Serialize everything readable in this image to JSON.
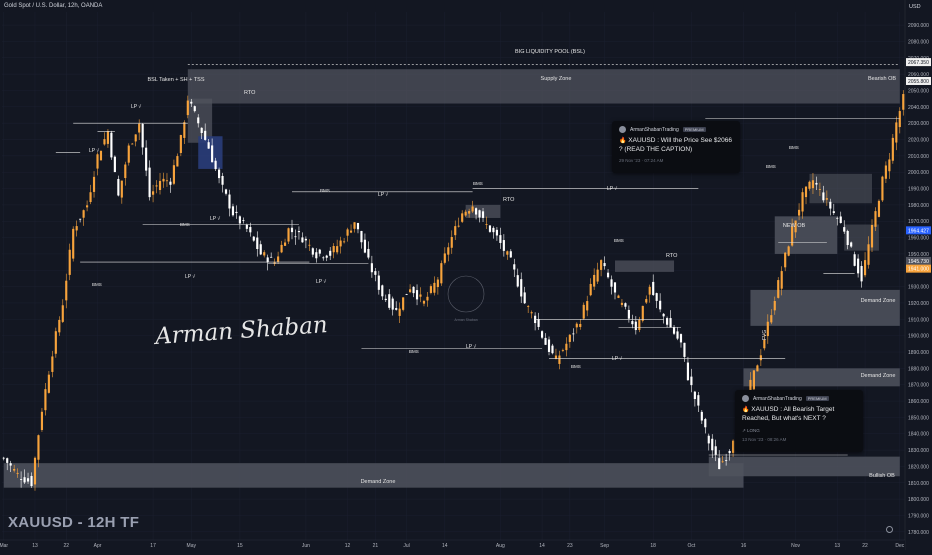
{
  "header": {
    "title": "Gold Spot / U.S. Dollar, 12h, OANDA",
    "currency": "USD"
  },
  "watermark": {
    "symbol": "XAUUSD - 12H TF",
    "signature": "Arman Shaban",
    "center_logo": "Arman Shaban"
  },
  "colors": {
    "background": "#131722",
    "up_candle": "#f7a33c",
    "down_candle": "#ffffff",
    "zone_fill": "#50535e",
    "zone_fill_dark": "#3b3e48",
    "rto_fill": "#2a3d7a",
    "grid": "#1c2030"
  },
  "price_axis": {
    "ticks": [
      "2090.000",
      "2080.000",
      "2070.000",
      "2060.000",
      "2050.000",
      "2040.000",
      "2030.000",
      "2020.000",
      "2010.000",
      "2000.000",
      "1990.000",
      "1980.000",
      "1970.000",
      "1960.000",
      "1950.000",
      "1940.000",
      "1930.000",
      "1920.000",
      "1910.000",
      "1900.000",
      "1890.000",
      "1880.000",
      "1870.000",
      "1860.000",
      "1850.000",
      "1840.000",
      "1830.000",
      "1820.000",
      "1810.000",
      "1800.000",
      "1790.000",
      "1780.000"
    ],
    "highlights": [
      {
        "label": "1964.427",
        "color": "#2962ff"
      },
      {
        "label": "1945.730",
        "color": "#50535e"
      },
      {
        "label": "1941.000",
        "color": "#f7a33c"
      },
      {
        "label": "2067.350",
        "color": "#f0f0f0"
      },
      {
        "label": "2055.800",
        "color": "#f0f0f0"
      }
    ],
    "countdown": "06:02:15"
  },
  "time_axis": {
    "ticks": [
      {
        "label": "Mar",
        "i": 0
      },
      {
        "label": "13",
        "i": 9
      },
      {
        "label": "22",
        "i": 18
      },
      {
        "label": "Apr",
        "i": 27
      },
      {
        "label": "17",
        "i": 43
      },
      {
        "label": "May",
        "i": 54
      },
      {
        "label": "15",
        "i": 68
      },
      {
        "label": "Jun",
        "i": 87
      },
      {
        "label": "12",
        "i": 99
      },
      {
        "label": "21",
        "i": 107
      },
      {
        "label": "Jul",
        "i": 116
      },
      {
        "label": "14",
        "i": 127
      },
      {
        "label": "Aug",
        "i": 143
      },
      {
        "label": "14",
        "i": 155
      },
      {
        "label": "23",
        "i": 163
      },
      {
        "label": "Sep",
        "i": 173
      },
      {
        "label": "18",
        "i": 187
      },
      {
        "label": "Oct",
        "i": 198
      },
      {
        "label": "16",
        "i": 213
      },
      {
        "label": "Nov",
        "i": 228
      },
      {
        "label": "13",
        "i": 240
      },
      {
        "label": "22",
        "i": 248
      },
      {
        "label": "Dec",
        "i": 258
      }
    ]
  },
  "annotations": {
    "big_liquidity": "BIG LIQUIDITY POOL (BSL)",
    "supply_zone": "Supply Zone",
    "bearish_ob": "Bearish OB",
    "bsl_taken": "BSL Taken + SH + TSS",
    "rto": "RTO",
    "lp": "LP",
    "bms": "BMS",
    "new_ob": "NEW OB",
    "demand_zone": "Demand Zone",
    "bullish_ob": "Bullish OB",
    "fvg": "FVG"
  },
  "ideas": [
    {
      "author": "ArmanShabanTrading",
      "badge": "PREMIUM",
      "title": "XAUUSD : Will the Price See $2066 ? (READ THE CAPTION)",
      "date": "29 Nov '23 · 07:24 AM",
      "tag": ""
    },
    {
      "author": "ArmanShabanTrading",
      "badge": "PREMIUM",
      "title": "XAUUSD : All Bearish Target Reached, But what's NEXT ?",
      "date": "13 Nov '23 · 08:26 AM",
      "tag": "LONG"
    }
  ],
  "chart_data": {
    "type": "candlestick",
    "title": "Gold Spot / U.S. Dollar, 12h, OANDA",
    "ylabel": "USD",
    "ylim": [
      1775,
      2098
    ],
    "x_count": 260,
    "anchors": [
      [
        0,
        1825
      ],
      [
        4,
        1815
      ],
      [
        8,
        1810
      ],
      [
        11,
        1855
      ],
      [
        14,
        1890
      ],
      [
        17,
        1920
      ],
      [
        20,
        1965
      ],
      [
        24,
        1980
      ],
      [
        27,
        2010
      ],
      [
        30,
        2025
      ],
      [
        33,
        1985
      ],
      [
        36,
        2015
      ],
      [
        39,
        2030
      ],
      [
        42,
        1985
      ],
      [
        45,
        1995
      ],
      [
        48,
        1995
      ],
      [
        51,
        2020
      ],
      [
        53,
        2045
      ],
      [
        56,
        2030
      ],
      [
        59,
        2015
      ],
      [
        62,
        1995
      ],
      [
        66,
        1975
      ],
      [
        70,
        1965
      ],
      [
        74,
        1950
      ],
      [
        78,
        1945
      ],
      [
        82,
        1965
      ],
      [
        86,
        1960
      ],
      [
        90,
        1950
      ],
      [
        94,
        1950
      ],
      [
        98,
        1960
      ],
      [
        101,
        1970
      ],
      [
        105,
        1945
      ],
      [
        109,
        1925
      ],
      [
        113,
        1915
      ],
      [
        117,
        1930
      ],
      [
        121,
        1920
      ],
      [
        125,
        1935
      ],
      [
        128,
        1955
      ],
      [
        132,
        1975
      ],
      [
        135,
        1980
      ],
      [
        138,
        1970
      ],
      [
        142,
        1960
      ],
      [
        146,
        1945
      ],
      [
        150,
        1920
      ],
      [
        153,
        1910
      ],
      [
        156,
        1895
      ],
      [
        159,
        1885
      ],
      [
        162,
        1895
      ],
      [
        166,
        1910
      ],
      [
        169,
        1930
      ],
      [
        172,
        1945
      ],
      [
        176,
        1925
      ],
      [
        179,
        1915
      ],
      [
        182,
        1905
      ],
      [
        186,
        1930
      ],
      [
        189,
        1915
      ],
      [
        192,
        1905
      ],
      [
        195,
        1895
      ],
      [
        197,
        1875
      ],
      [
        200,
        1855
      ],
      [
        203,
        1835
      ],
      [
        206,
        1820
      ],
      [
        209,
        1830
      ],
      [
        212,
        1855
      ],
      [
        215,
        1870
      ],
      [
        218,
        1890
      ],
      [
        221,
        1915
      ],
      [
        224,
        1940
      ],
      [
        227,
        1965
      ],
      [
        230,
        1985
      ],
      [
        233,
        1995
      ],
      [
        236,
        1985
      ],
      [
        239,
        1975
      ],
      [
        242,
        1965
      ],
      [
        245,
        1945
      ],
      [
        247,
        1935
      ],
      [
        249,
        1955
      ],
      [
        251,
        1975
      ],
      [
        253,
        1995
      ],
      [
        255,
        2010
      ],
      [
        257,
        2030
      ],
      [
        259,
        2045
      ]
    ]
  }
}
